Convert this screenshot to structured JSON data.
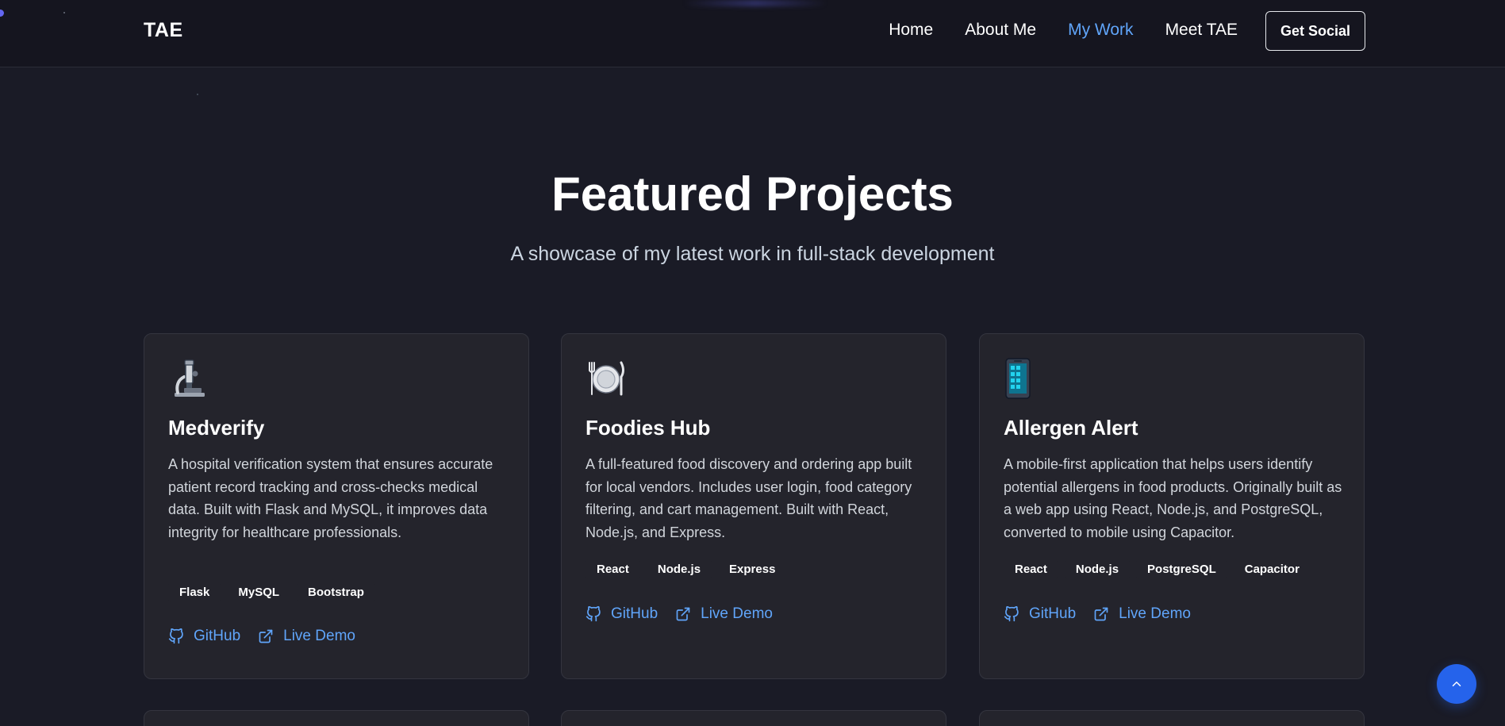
{
  "nav": {
    "brand": "TAE",
    "links": [
      {
        "label": "Home",
        "active": false
      },
      {
        "label": "About Me",
        "active": false
      },
      {
        "label": "My Work",
        "active": true
      },
      {
        "label": "Meet TAE",
        "active": false
      }
    ],
    "cta_label": "Get Social"
  },
  "hero": {
    "title": "Featured Projects",
    "subtitle": "A showcase of my latest work in full-stack development"
  },
  "projects": [
    {
      "icon": "microscope-icon",
      "title": "Medverify",
      "description": "A hospital verification system that ensures accurate patient record tracking and cross-checks medical data. Built with Flask and MySQL, it improves data integrity for healthcare professionals.",
      "tags": [
        "Flask",
        "MySQL",
        "Bootstrap"
      ],
      "github_label": "GitHub",
      "demo_label": "Live Demo"
    },
    {
      "icon": "plate-cutlery-icon",
      "title": "Foodies Hub",
      "description": "A full-featured food discovery and ordering app built for local vendors. Includes user login, food category filtering, and cart management. Built with React, Node.js, and Express.",
      "tags": [
        "React",
        "Node.js",
        "Express"
      ],
      "github_label": "GitHub",
      "demo_label": "Live Demo"
    },
    {
      "icon": "mobile-phone-icon",
      "title": "Allergen Alert",
      "description": "A mobile-first application that helps users identify potential allergens in food products. Originally built as a web app using React, Node.js, and PostgreSQL, converted to mobile using Capacitor.",
      "tags": [
        "React",
        "Node.js",
        "PostgreSQL",
        "Capacitor"
      ],
      "github_label": "GitHub",
      "demo_label": "Live Demo"
    }
  ],
  "colors": {
    "background": "#1a1b26",
    "navbar": "#15151f",
    "card": "#24242c",
    "accent": "#60a5fa",
    "scroll_button": "#2563eb"
  }
}
